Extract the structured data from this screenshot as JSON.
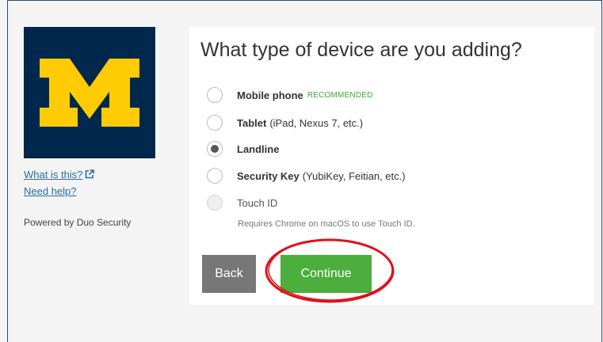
{
  "sidebar": {
    "logo_letter": "M",
    "what_is_this": "What is this?",
    "need_help": "Need help?",
    "powered_by": "Powered by Duo Security"
  },
  "prompt": {
    "title": "What type of device are you adding?",
    "options": [
      {
        "label": "Mobile phone",
        "badge": "RECOMMENDED",
        "selected": false
      },
      {
        "label": "Tablet",
        "detail": "(iPad, Nexus 7, etc.)",
        "selected": false
      },
      {
        "label": "Landline",
        "selected": true
      },
      {
        "label": "Security Key",
        "detail": "(YubiKey, Feitian, etc.)",
        "selected": false
      },
      {
        "label": "Touch ID",
        "disabled": true,
        "selected": false
      }
    ],
    "touch_id_note": "Requires Chrome on macOS to use Touch ID."
  },
  "buttons": {
    "back": "Back",
    "continue": "Continue"
  },
  "colors": {
    "logo_bg": "#00274c",
    "logo_fg": "#ffcb05",
    "link": "#2d6ca2",
    "continue_btn": "#4cae3d",
    "back_btn": "#777777",
    "highlight": "#e0101a",
    "badge": "#3fa637"
  }
}
